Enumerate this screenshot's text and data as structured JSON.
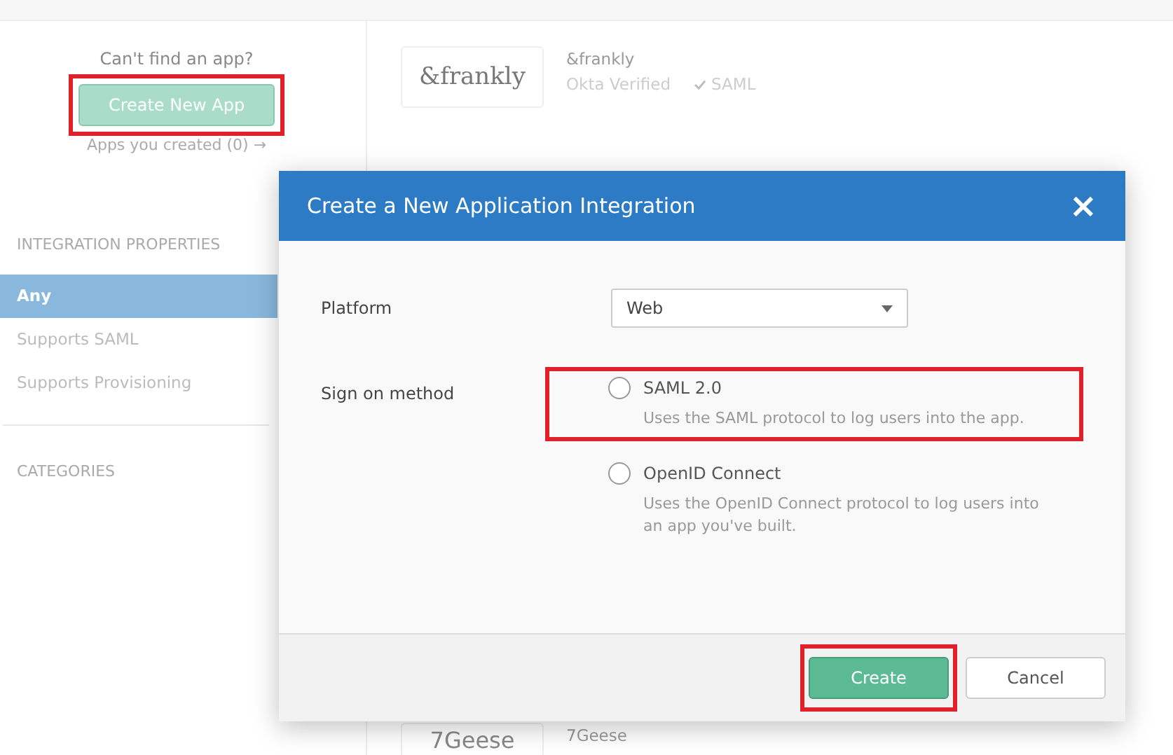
{
  "sidebar": {
    "prompt": "Can't find an app?",
    "create_button": {
      "label": "Create New App",
      "highlighted": true
    },
    "apps_link": "Apps you created (0) →",
    "properties_heading": "INTEGRATION PROPERTIES",
    "filters": [
      {
        "label": "Any",
        "selected": true
      },
      {
        "label": "Supports SAML",
        "selected": false
      },
      {
        "label": "Supports Provisioning",
        "selected": false
      }
    ],
    "categories_heading": "CATEGORIES"
  },
  "apps": [
    {
      "logo": "&frankly",
      "name": "&frankly",
      "verified": "Okta Verified",
      "feature": "SAML"
    },
    {
      "logo": "7Geese",
      "name": "7Geese"
    }
  ],
  "dialog": {
    "title": "Create a New Application Integration",
    "close": "×",
    "platform_label": "Platform",
    "platform_value": "Web",
    "method_label": "Sign on method",
    "methods": [
      {
        "label": "SAML 2.0",
        "description": "Uses the SAML protocol to log users into the app.",
        "selected": false,
        "highlighted": true
      },
      {
        "label": "OpenID Connect",
        "description": "Uses the OpenID Connect protocol to log users into an app you've built.",
        "selected": false,
        "highlighted": false
      }
    ],
    "create_button": {
      "label": "Create",
      "highlighted": true
    },
    "cancel_button": "Cancel"
  }
}
